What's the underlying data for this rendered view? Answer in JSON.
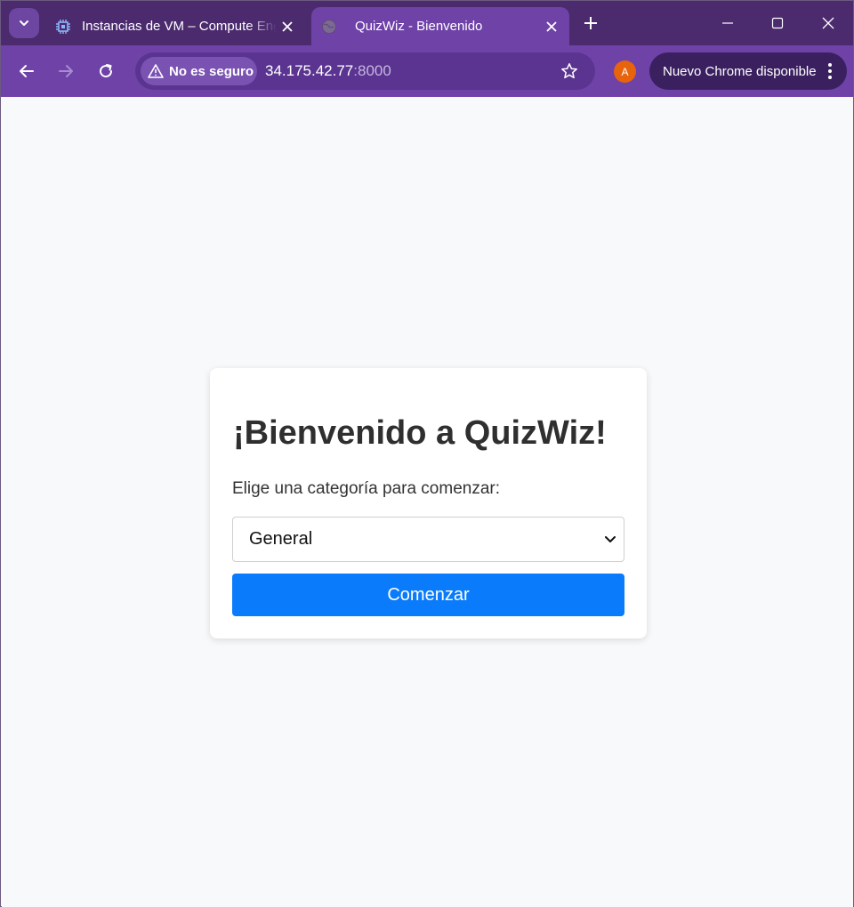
{
  "browser": {
    "tabs": [
      {
        "title": "Instancias de VM – Compute Engine",
        "icon": "chip-icon",
        "active": false
      },
      {
        "title": "QuizWiz - Bienvenido",
        "icon": "globe-icon",
        "active": true
      }
    ],
    "omnibox": {
      "security_label": "No es seguro",
      "url_host": "34.175.42.77",
      "url_port": ":8000"
    },
    "profile_initial": "A",
    "update_label": "Nuevo Chrome disponible"
  },
  "page": {
    "heading": "¡Bienvenido a QuizWiz!",
    "prompt": "Elige una categoría para comenzar:",
    "category_selected": "General",
    "start_button": "Comenzar"
  },
  "colors": {
    "tabstrip": "#4b2a6e",
    "toolbar": "#6f42a8",
    "page_bg": "#f8f9fa",
    "primary_button": "#0a7bfa"
  }
}
